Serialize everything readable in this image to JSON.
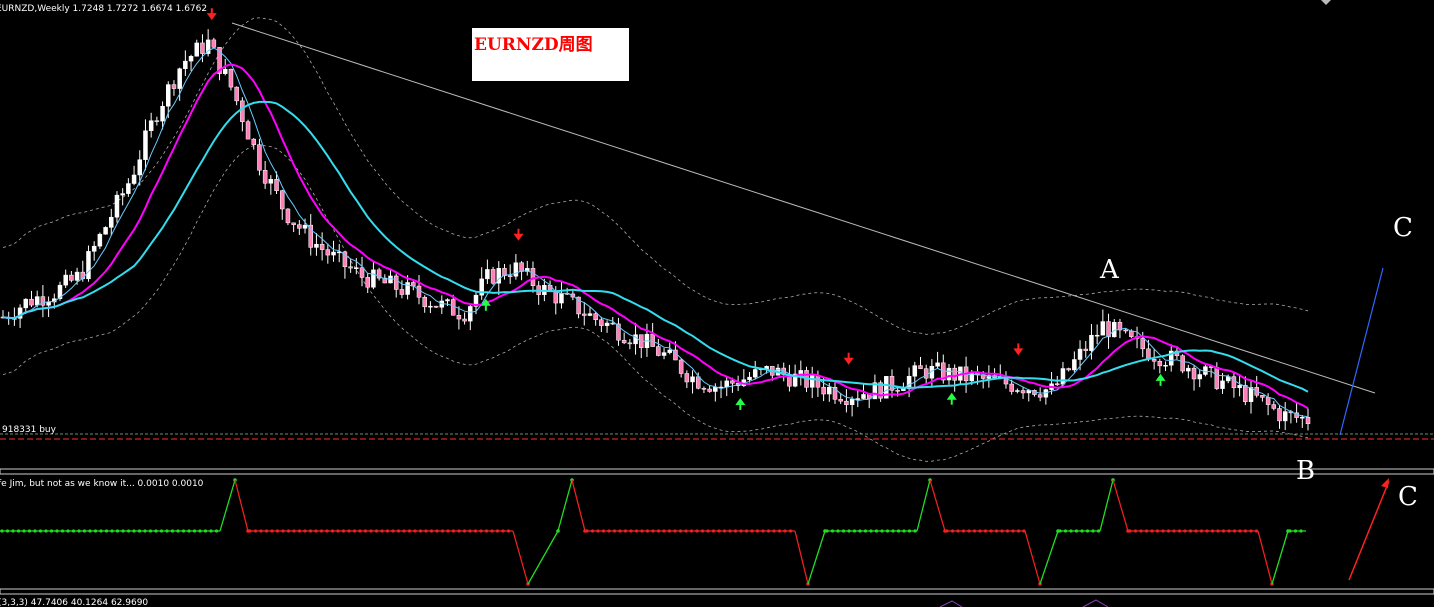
{
  "chart_data": {
    "type": "candlestick",
    "header": "EURNZD,Weekly  1.7248 1.7272 1.6674 1.6762",
    "title_box": "EURNZD周图",
    "order_label": "918331 buy",
    "indicator_label": "fe Jim, but not as we know it...  0.0010 0.0010",
    "stoch_label": "(3,3,3) 47.7406 40.1264 62.9690",
    "annotations": {
      "a": "A",
      "b": "B",
      "c_top": "C",
      "c_bottom": "C"
    },
    "ohlc": {
      "last_open": 1.7248,
      "last_high": 1.7272,
      "last_low": 1.6674,
      "last_close": 1.6762
    },
    "close_path": [
      0.3,
      0.34,
      0.36,
      0.4,
      0.52,
      0.64,
      0.8,
      0.92,
      0.97,
      0.85,
      0.68,
      0.56,
      0.49,
      0.44,
      0.4,
      0.38,
      0.36,
      0.33,
      0.31,
      0.4,
      0.42,
      0.37,
      0.34,
      0.3,
      0.27,
      0.24,
      0.2,
      0.15,
      0.13,
      0.15,
      0.17,
      0.15,
      0.13,
      0.11,
      0.12,
      0.14,
      0.17,
      0.16,
      0.15,
      0.14,
      0.13,
      0.12,
      0.2,
      0.28,
      0.24,
      0.21,
      0.19,
      0.16,
      0.13,
      0.1,
      0.06,
      0.05
    ],
    "arrows_down": [
      0.16,
      0.395,
      0.648,
      0.778
    ],
    "arrows_up": [
      0.37,
      0.565,
      0.727,
      0.887
    ],
    "colors": {
      "background": "#000000",
      "bull": "#ffffff",
      "bear": "#ff7fb8",
      "ma_fast": "#ff00ff",
      "ma_slow": "#33ddee",
      "ma_thin": "#66ccff",
      "envelope": "#aaaaaa",
      "trendline": "#bbbbbb",
      "arrow_down": "#ff2020",
      "arrow_up": "#22ff44",
      "ind_up": "#22dd22",
      "ind_down": "#ee2020",
      "c_line_main": "#3366ff",
      "c_line_ind": "#ff2020"
    }
  }
}
